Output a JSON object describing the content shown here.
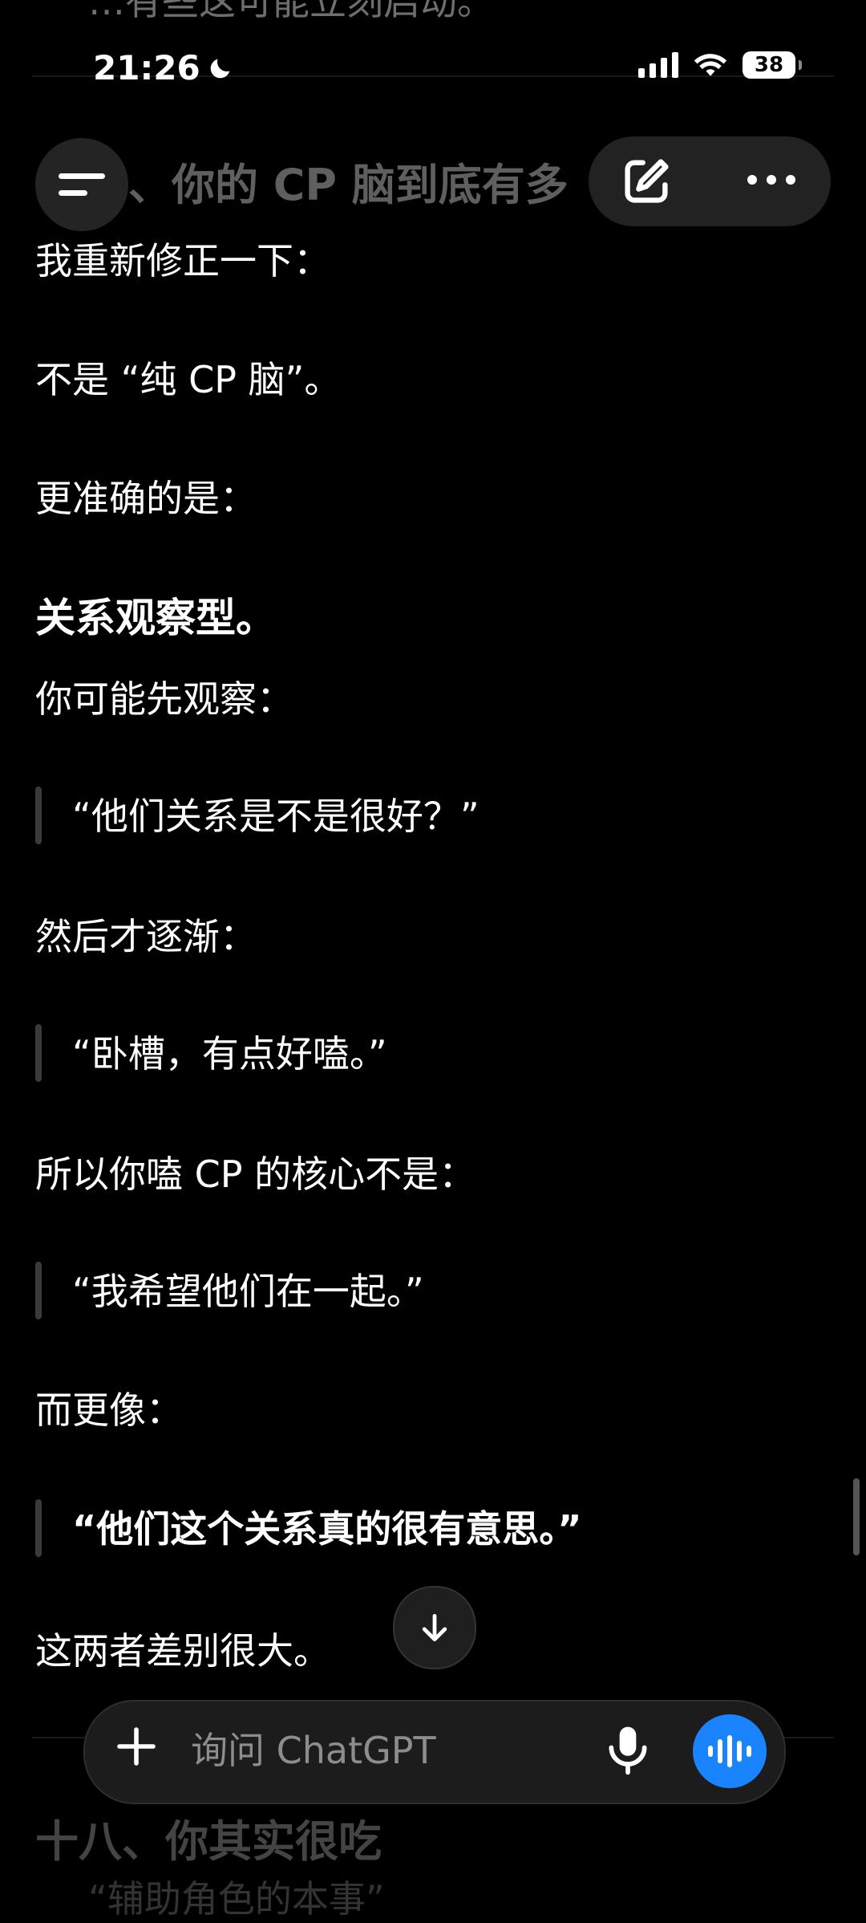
{
  "status_bar": {
    "time": "21:26",
    "battery": "38"
  },
  "background": {
    "top_faded_text": "…有些这可能立刻启动。",
    "section_header": "、你的 CP 脑到底有多",
    "next_section_title": "十八、你其实很吃",
    "next_section_subtitle": "“辅助角色的本事”"
  },
  "message": {
    "p1": "我重新修正一下：",
    "p2": "不是 “纯 CP 脑”。",
    "p3": "更准确的是：",
    "p4_bold": "关系观察型。",
    "p5": "你可能先观察：",
    "q1": "“他们关系是不是很好？”",
    "p6": "然后才逐渐：",
    "q2": "“卧槽，有点好嗑。”",
    "p7": "所以你嗑 CP 的核心不是：",
    "q3": "“我希望他们在一起。”",
    "p8": "而更像：",
    "q4_bold": "“他们这个关系真的很有意思。”",
    "p9": "这两者差别很大。"
  },
  "composer": {
    "placeholder": "询问 ChatGPT"
  },
  "icons": {
    "menu": "menu-icon",
    "compose": "new-chat-icon",
    "more": "more-icon",
    "scroll_down": "arrow-down-icon",
    "plus": "plus-icon",
    "mic": "microphone-icon",
    "voice": "voice-mode-icon"
  },
  "colors": {
    "background": "#000000",
    "accent_blue": "#1a84ff"
  }
}
